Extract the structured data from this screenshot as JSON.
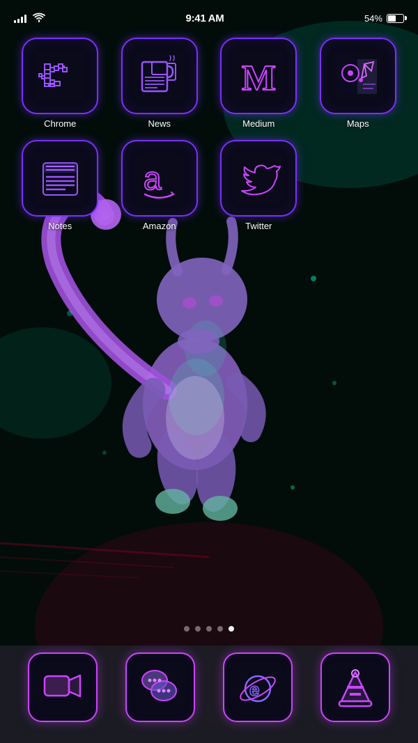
{
  "statusBar": {
    "time": "9:41 AM",
    "battery": "54%",
    "signalBars": 4
  },
  "apps": [
    {
      "id": "chrome",
      "label": "Chrome",
      "iconType": "chrome"
    },
    {
      "id": "news",
      "label": "News",
      "iconType": "news"
    },
    {
      "id": "medium",
      "label": "Medium",
      "iconType": "medium"
    },
    {
      "id": "maps",
      "label": "Maps",
      "iconType": "maps"
    },
    {
      "id": "notes",
      "label": "Notes",
      "iconType": "notes"
    },
    {
      "id": "amazon",
      "label": "Amazon",
      "iconType": "amazon"
    },
    {
      "id": "twitter",
      "label": "Twitter",
      "iconType": "twitter"
    }
  ],
  "pageDots": {
    "total": 5,
    "active": 4
  },
  "dock": [
    {
      "id": "facetime",
      "iconType": "facetime"
    },
    {
      "id": "messages",
      "iconType": "messages"
    },
    {
      "id": "ie",
      "iconType": "ie"
    },
    {
      "id": "vlc",
      "iconType": "vlc"
    }
  ]
}
